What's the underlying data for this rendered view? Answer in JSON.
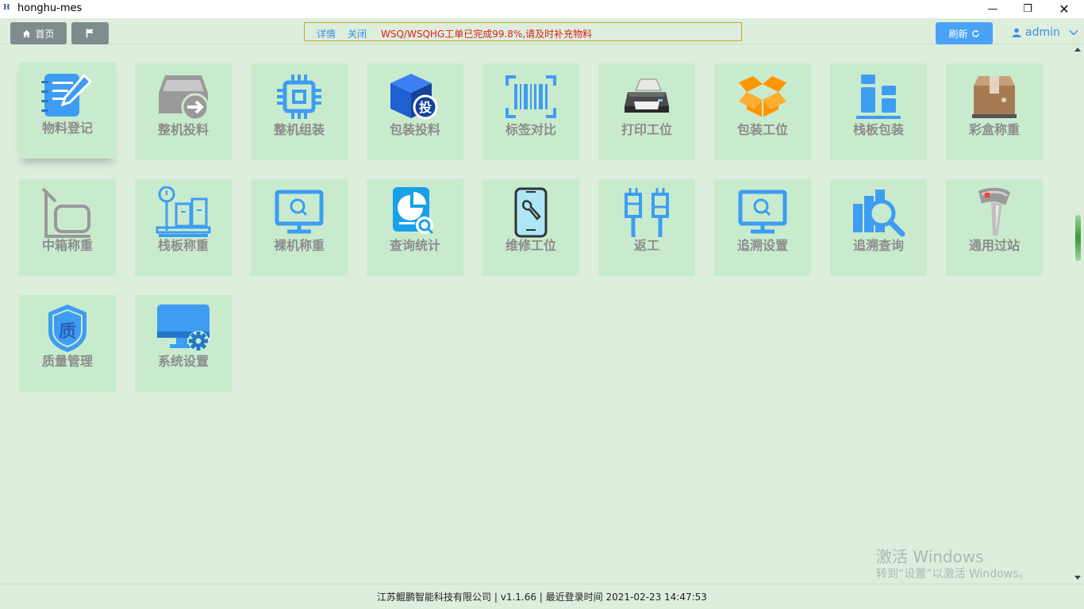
{
  "window": {
    "title": "honghu-mes",
    "icon_text": "H",
    "minimize": "—",
    "restore": "❐",
    "close": "✕"
  },
  "toolbar": {
    "home_label": "首页",
    "notice": {
      "detail": "详情",
      "close": "关闭",
      "message": "WSQ/WSQHG工单已完成99.8%,请及时补充物料"
    },
    "refresh_label": "刷新",
    "user": "admin"
  },
  "tiles": [
    {
      "label": "物料登记",
      "icon": "notebook-pen-icon"
    },
    {
      "label": "整机投料",
      "icon": "box-arrow-icon"
    },
    {
      "label": "整机组装",
      "icon": "chip-icon"
    },
    {
      "label": "包装投料",
      "icon": "cube-tou-icon"
    },
    {
      "label": "标签对比",
      "icon": "barcode-icon"
    },
    {
      "label": "打印工位",
      "icon": "printer-icon"
    },
    {
      "label": "包装工位",
      "icon": "open-box-icon"
    },
    {
      "label": "栈板包装",
      "icon": "pallet-stack-icon"
    },
    {
      "label": "彩盒称重",
      "icon": "carton-icon"
    },
    {
      "label": "中箱称重",
      "icon": "scale-frame-icon"
    },
    {
      "label": "栈板称重",
      "icon": "platform-scale-icon"
    },
    {
      "label": "裸机称重",
      "icon": "monitor-search-icon"
    },
    {
      "label": "查询统计",
      "icon": "report-search-icon"
    },
    {
      "label": "维修工位",
      "icon": "phone-wrench-icon"
    },
    {
      "label": "返工",
      "icon": "plug-icon"
    },
    {
      "label": "追溯设置",
      "icon": "monitor-search-icon"
    },
    {
      "label": "追溯查询",
      "icon": "chart-magnifier-icon"
    },
    {
      "label": "通用过站",
      "icon": "barcode-scanner-icon"
    },
    {
      "label": "质量管理",
      "icon": "shield-quality-icon"
    },
    {
      "label": "系统设置",
      "icon": "monitor-gear-icon"
    }
  ],
  "quality_glyph": "质",
  "tou_glyph": "投",
  "watermark": {
    "line1": "激活 Windows",
    "line2": "转到“设置”以激活 Windows。"
  },
  "footer": "江苏鲲鹏智能科技有限公司 | v1.1.66 | 最近登录时间 2021-02-23 14:47:53",
  "colors": {
    "accent": "#3a8ee6",
    "tile_bg": "#c9ebcd",
    "page_bg": "#ddeedd",
    "notice_text": "#e02020",
    "icon_blue": "#3d9df3",
    "icon_orange": "#ff9500"
  }
}
